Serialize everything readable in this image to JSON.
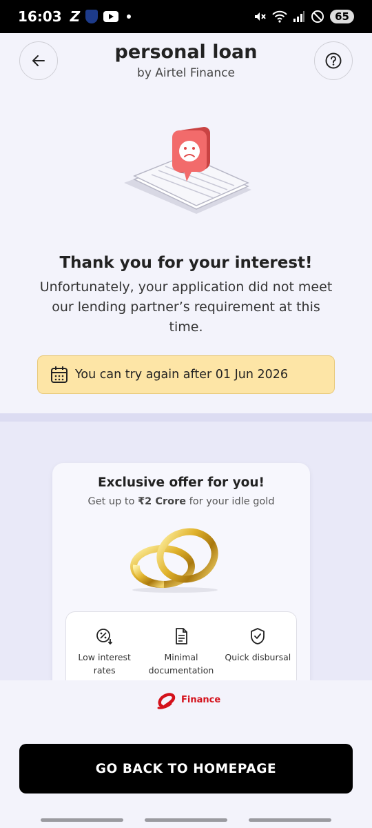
{
  "status_bar": {
    "time": "16:03",
    "battery": "65",
    "left_icons": [
      "z-icon",
      "shield-icon",
      "youtube-icon",
      "dot-icon"
    ],
    "right_icons": [
      "mute-icon",
      "wifi-icon",
      "signal-icon",
      "dnd-icon",
      "battery-icon"
    ]
  },
  "header": {
    "title": "personal loan",
    "subtitle": "by Airtel Finance"
  },
  "result": {
    "heading": "Thank you for your interest!",
    "message": "Unfortunately, your application did not meet our lending partner’s requirement at this time.",
    "retry_text": "You can try again after 01 Jun 2026"
  },
  "offer": {
    "title": "Exclusive offer for you!",
    "subtitle_prefix": "Get up to ",
    "subtitle_amount": "₹2 Crore",
    "subtitle_suffix": " for your idle gold",
    "features": [
      {
        "icon": "percent-down-icon",
        "label": "Low interest rates"
      },
      {
        "icon": "document-icon",
        "label": "Minimal documentation"
      },
      {
        "icon": "shield-check-icon",
        "label": "Quick disbursal"
      }
    ]
  },
  "brand": {
    "text": "Finance",
    "color": "#d4111b"
  },
  "cta": {
    "label": "GO BACK TO HOMEPAGE"
  },
  "colors": {
    "background": "#f3f3fb",
    "banner": "#fde5a6",
    "sad_pin": "#f26b6b",
    "cta_bg": "#000000"
  }
}
